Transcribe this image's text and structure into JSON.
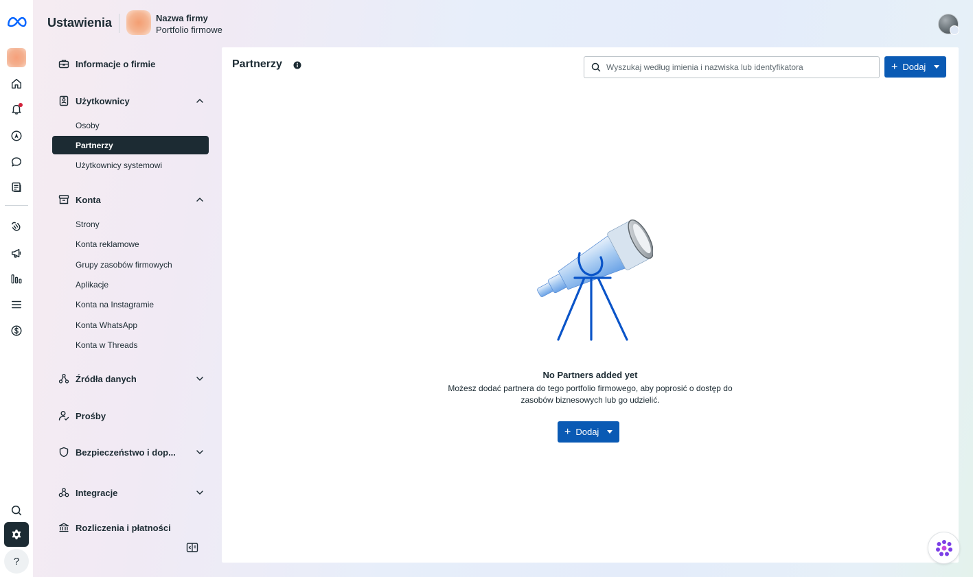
{
  "header": {
    "title": "Ustawienia",
    "business_name": "Nazwa firmy",
    "business_subtitle": "Portfolio firmowe"
  },
  "rail": {
    "icons": [
      "meta-logo-icon",
      "business-avatar",
      "home-icon",
      "bell-icon",
      "compass-icon",
      "chat-icon",
      "pages-icon",
      "hand-wave-icon",
      "megaphone-icon",
      "chart-bars-icon",
      "menu-icon",
      "dollar-circle-icon",
      "search-icon",
      "gear-icon",
      "help-icon"
    ],
    "help_label": "?"
  },
  "nav": {
    "company_info": "Informacje o firmie",
    "users": {
      "label": "Użytkownicy",
      "items": [
        "Osoby",
        "Partnerzy",
        "Użytkownicy systemowi"
      ]
    },
    "accounts": {
      "label": "Konta",
      "items": [
        "Strony",
        "Konta reklamowe",
        "Grupy zasobów firmowych",
        "Aplikacje",
        "Konta na Instagramie",
        "Konta WhatsApp",
        "Konta w Threads"
      ]
    },
    "data_sources": "Źródła danych",
    "requests": "Prośby",
    "security": "Bezpieczeństwo i dop...",
    "integrations": "Integracje",
    "billing": "Rozliczenia i płatności",
    "active_item": "Partnerzy"
  },
  "main": {
    "title": "Partnerzy",
    "search_placeholder": "Wyszukaj według imienia i nazwiska lub identyfikatora",
    "add_label": "Dodaj",
    "empty_title": "No Partners added yet",
    "empty_text": "Możesz dodać partnera do tego portfolio firmowego, aby poprosić o dostęp do zasobów biznesowych lub go udzielić.",
    "empty_add_label": "Dodaj"
  },
  "colors": {
    "primary": "#0a5ab4",
    "dark": "#1c2b33",
    "notification": "#d1223b"
  }
}
